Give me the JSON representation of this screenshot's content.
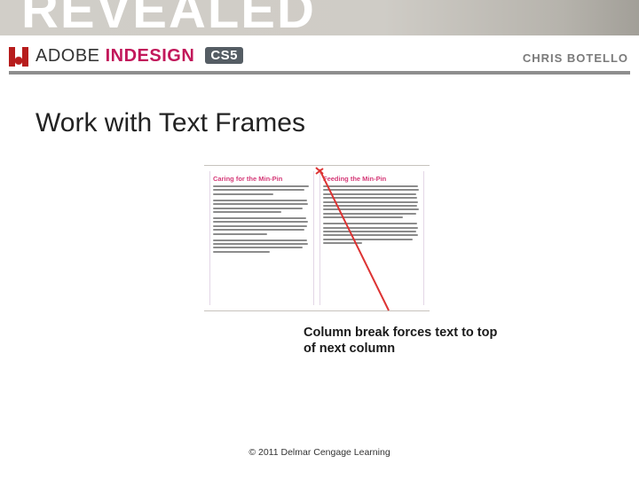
{
  "header": {
    "series_word": "REVEALED",
    "brand_prefix": "ADOBE ",
    "brand_suffix": "INDESIGN",
    "version_badge": "CS5",
    "author": "CHRIS BOTELLO"
  },
  "slide": {
    "title": "Work with Text Frames",
    "caption": "Column break forces text to top of next column",
    "copyright": "© 2011 Delmar Cengage Learning"
  },
  "figure": {
    "col1_heading": "Caring for the Min-Pin",
    "col2_heading": "Feeding the Min-Pin"
  }
}
